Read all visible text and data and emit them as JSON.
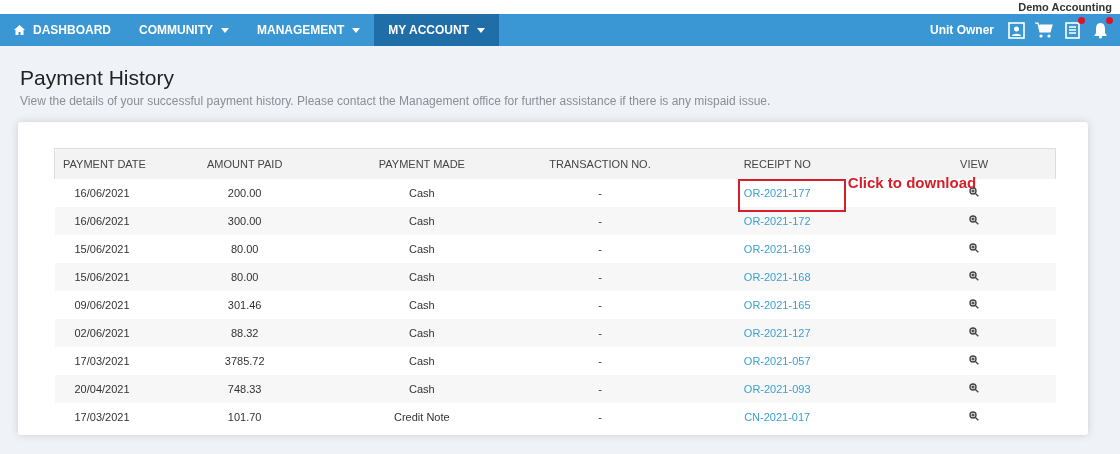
{
  "top_bar": {
    "company": "Demo Accounting"
  },
  "nav": {
    "items": [
      {
        "label": "DASHBOARD",
        "kind": "home",
        "selected": false
      },
      {
        "label": "COMMUNITY",
        "kind": "dropdown",
        "selected": false
      },
      {
        "label": "MANAGEMENT",
        "kind": "dropdown",
        "selected": false
      },
      {
        "label": "MY ACCOUNT",
        "kind": "dropdown",
        "selected": true
      }
    ],
    "user_role": "Unit Owner",
    "icons": [
      {
        "kind": "profile",
        "badge": false
      },
      {
        "kind": "cart",
        "badge": false
      },
      {
        "kind": "document",
        "badge": true
      },
      {
        "kind": "bell",
        "badge": true
      }
    ]
  },
  "page": {
    "title": "Payment History",
    "description": "View the details of your successful payment history. Please contact the Management office for further assistance if there is any mispaid issue."
  },
  "table": {
    "columns": [
      "PAYMENT DATE",
      "AMOUNT PAID",
      "PAYMENT MADE",
      "TRANSACTION NO.",
      "RECEIPT NO",
      "VIEW"
    ],
    "rows": [
      {
        "date": "16/06/2021",
        "amount": "200.00",
        "method": "Cash",
        "transaction": "-",
        "receipt": "OR-2021-177",
        "highlighted": true
      },
      {
        "date": "16/06/2021",
        "amount": "300.00",
        "method": "Cash",
        "transaction": "-",
        "receipt": "OR-2021-172",
        "highlighted": false
      },
      {
        "date": "15/06/2021",
        "amount": "80.00",
        "method": "Cash",
        "transaction": "-",
        "receipt": "OR-2021-169",
        "highlighted": false
      },
      {
        "date": "15/06/2021",
        "amount": "80.00",
        "method": "Cash",
        "transaction": "-",
        "receipt": "OR-2021-168",
        "highlighted": false
      },
      {
        "date": "09/06/2021",
        "amount": "301.46",
        "method": "Cash",
        "transaction": "-",
        "receipt": "OR-2021-165",
        "highlighted": false
      },
      {
        "date": "02/06/2021",
        "amount": "88.32",
        "method": "Cash",
        "transaction": "-",
        "receipt": "OR-2021-127",
        "highlighted": false
      },
      {
        "date": "17/03/2021",
        "amount": "3785.72",
        "method": "Cash",
        "transaction": "-",
        "receipt": "OR-2021-057",
        "highlighted": false
      },
      {
        "date": "20/04/2021",
        "amount": "748.33",
        "method": "Cash",
        "transaction": "-",
        "receipt": "OR-2021-093",
        "highlighted": false
      },
      {
        "date": "17/03/2021",
        "amount": "101.70",
        "method": "Credit Note",
        "transaction": "-",
        "receipt": "CN-2021-017",
        "highlighted": false
      }
    ]
  },
  "annotation": {
    "text": "Click to download"
  }
}
